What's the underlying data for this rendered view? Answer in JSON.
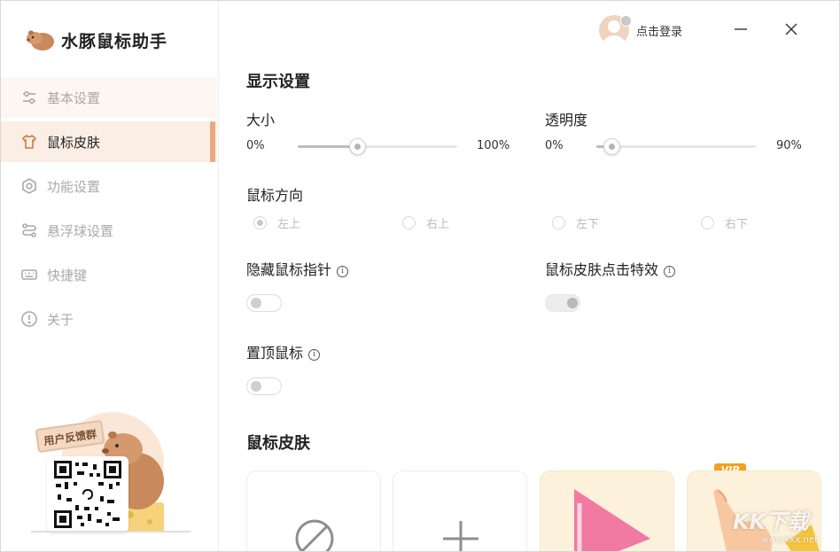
{
  "app": {
    "title": "水豚鼠标助手"
  },
  "sidebar": {
    "items": [
      {
        "label": "基本设置",
        "icon": "sliders-icon"
      },
      {
        "label": "鼠标皮肤",
        "icon": "tshirt-icon"
      },
      {
        "label": "功能设置",
        "icon": "hexagon-gear-icon"
      },
      {
        "label": "悬浮球设置",
        "icon": "route-icon"
      },
      {
        "label": "快捷键",
        "icon": "keyboard-icon"
      },
      {
        "label": "关于",
        "icon": "info-circle-icon"
      }
    ],
    "active_index": 1,
    "promo_label": "用户反馈群"
  },
  "header": {
    "login_label": "点击登录"
  },
  "display": {
    "title": "显示设置",
    "size": {
      "label": "大小",
      "min": "0%",
      "max": "100%",
      "value_fraction": 0.38
    },
    "opacity": {
      "label": "透明度",
      "min": "0%",
      "max": "90%",
      "value_fraction": 0.1
    },
    "direction": {
      "label": "鼠标方向",
      "options": [
        "左上",
        "右上",
        "左下",
        "右下"
      ],
      "selected": "左上"
    },
    "hide_pointer": {
      "label": "隐藏鼠标指针",
      "on": false
    },
    "click_effect": {
      "label": "鼠标皮肤点击特效",
      "on": true
    },
    "top_most": {
      "label": "置顶鼠标",
      "on": false
    }
  },
  "skins": {
    "title": "鼠标皮肤",
    "vip_badge": "VIP"
  },
  "watermark": {
    "text": "KK下载",
    "sub": "www.kkx.net"
  },
  "colors": {
    "accent": "#e8a97f",
    "active_bg": "#fbeee4",
    "vip": "#f4a11f"
  }
}
